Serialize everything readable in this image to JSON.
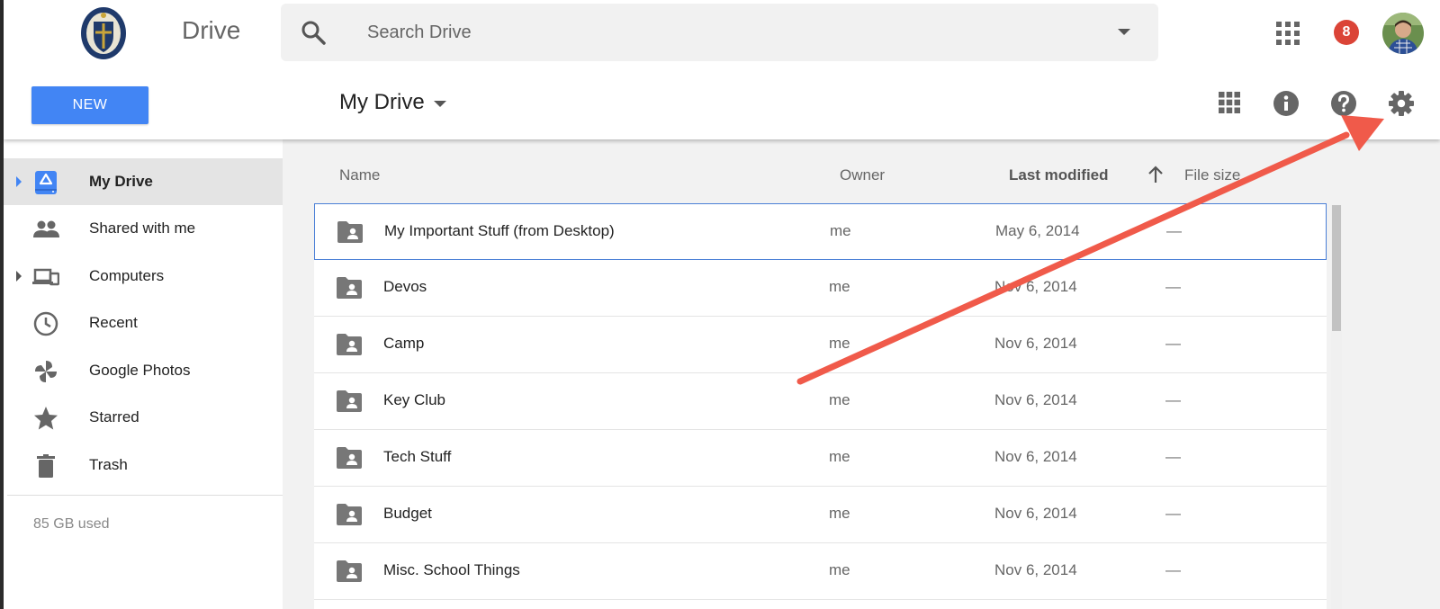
{
  "header": {
    "app_name": "Drive",
    "search": {
      "placeholder": "Search Drive",
      "value": ""
    },
    "notification_count": "8",
    "icons": [
      "search-icon",
      "apps-grid-icon",
      "avatar"
    ]
  },
  "toolbar": {
    "new_label": "NEW",
    "breadcrumb": "My Drive",
    "icons": [
      "grid-view-icon",
      "info-icon",
      "help-icon",
      "settings-gear-icon"
    ]
  },
  "sidebar": {
    "items": [
      {
        "label": "My Drive",
        "icon": "drive-icon",
        "active": true
      },
      {
        "label": "Shared with me",
        "icon": "people-icon"
      },
      {
        "label": "Computers",
        "icon": "computers-icon"
      },
      {
        "label": "Recent",
        "icon": "clock-icon"
      },
      {
        "label": "Google Photos",
        "icon": "pinwheel-icon"
      },
      {
        "label": "Starred",
        "icon": "star-icon"
      },
      {
        "label": "Trash",
        "icon": "trash-icon"
      }
    ],
    "storage": "85 GB used"
  },
  "file_list": {
    "columns": {
      "name": "Name",
      "owner": "Owner",
      "modified": "Last modified",
      "size": "File size"
    },
    "rows": [
      {
        "name": "My Important Stuff (from Desktop)",
        "owner": "me",
        "modified": "May 6, 2014",
        "size": "—"
      },
      {
        "name": "Devos",
        "owner": "me",
        "modified": "Nov 6, 2014",
        "size": "—"
      },
      {
        "name": "Camp",
        "owner": "me",
        "modified": "Nov 6, 2014",
        "size": "—"
      },
      {
        "name": "Key Club",
        "owner": "me",
        "modified": "Nov 6, 2014",
        "size": "—"
      },
      {
        "name": "Tech Stuff",
        "owner": "me",
        "modified": "Nov 6, 2014",
        "size": "—"
      },
      {
        "name": "Budget",
        "owner": "me",
        "modified": "Nov 6, 2014",
        "size": "—"
      },
      {
        "name": "Misc. School Things",
        "owner": "me",
        "modified": "Nov 6, 2014",
        "size": "—"
      }
    ]
  },
  "colors": {
    "accent": "#4285f4",
    "badge": "#db4437",
    "annotation_arrow": "#f05a4a"
  }
}
